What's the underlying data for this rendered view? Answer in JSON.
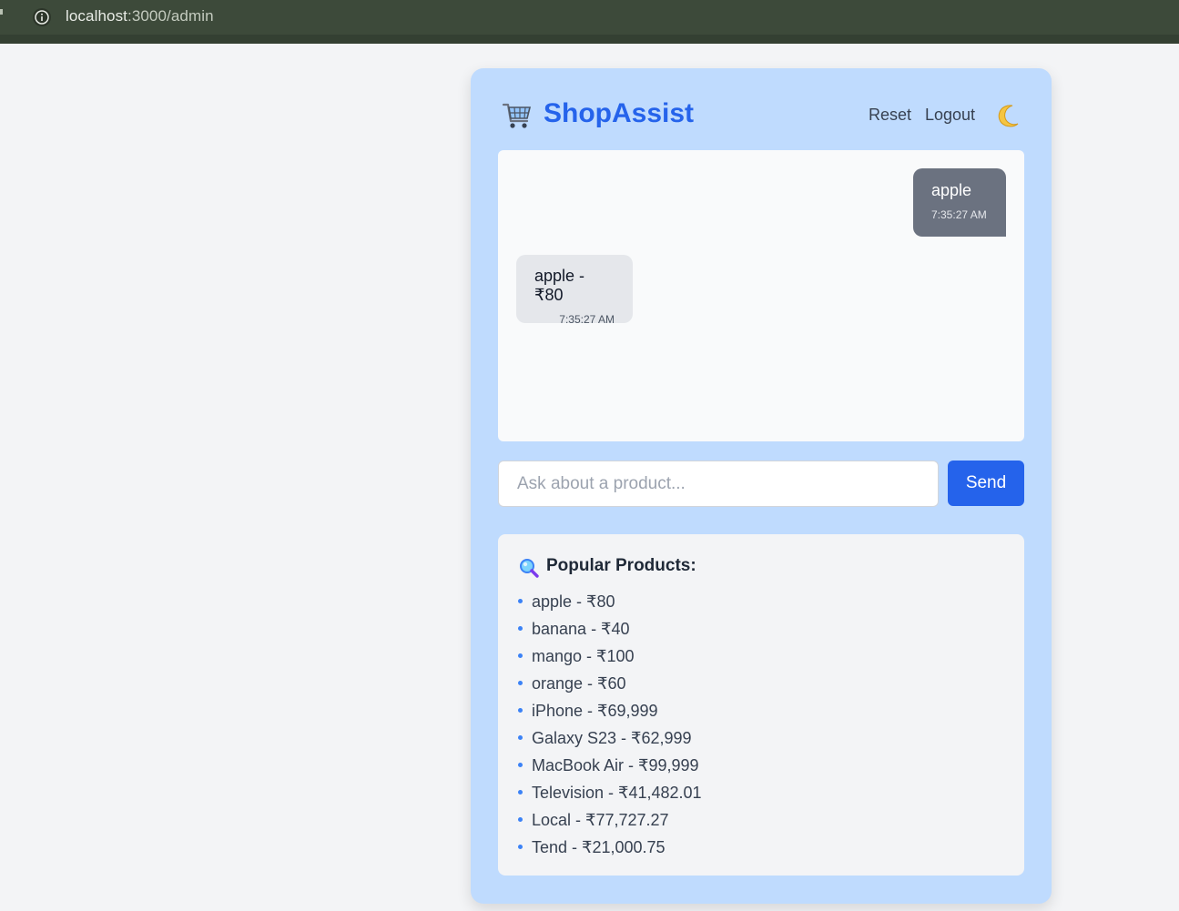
{
  "browser": {
    "url_host": "localhost",
    "url_path": ":3000/admin",
    "info_icon": "info-icon"
  },
  "header": {
    "logo_icon": "shopping-cart-icon",
    "brand": "ShopAssist",
    "reset_label": "Reset",
    "logout_label": "Logout",
    "theme_icon": "crescent-moon-icon"
  },
  "chat": {
    "messages": [
      {
        "sender": "user",
        "text": "apple",
        "time": "7:35:27 AM"
      },
      {
        "sender": "bot",
        "text": "apple - ₹80",
        "time": "7:35:27 AM"
      }
    ]
  },
  "composer": {
    "placeholder": "Ask about a product...",
    "value": "",
    "send_label": "Send"
  },
  "popular": {
    "icon": "magnifying-glass-icon",
    "title": "Popular Products:",
    "items": [
      "apple - ₹80",
      "banana - ₹40",
      "mango - ₹100",
      "orange - ₹60",
      "iPhone - ₹69,999",
      "Galaxy S23 - ₹62,999",
      "MacBook Air - ₹99,999",
      "Television - ₹41,482.01",
      "Local - ₹77,727.27",
      "Tend - ₹21,000.75"
    ]
  },
  "colors": {
    "brand": "#2563eb",
    "card_background": "#bfdbfe",
    "user_bubble": "#6b7280",
    "bot_bubble": "#e5e7eb",
    "send_button": "#2563eb"
  }
}
